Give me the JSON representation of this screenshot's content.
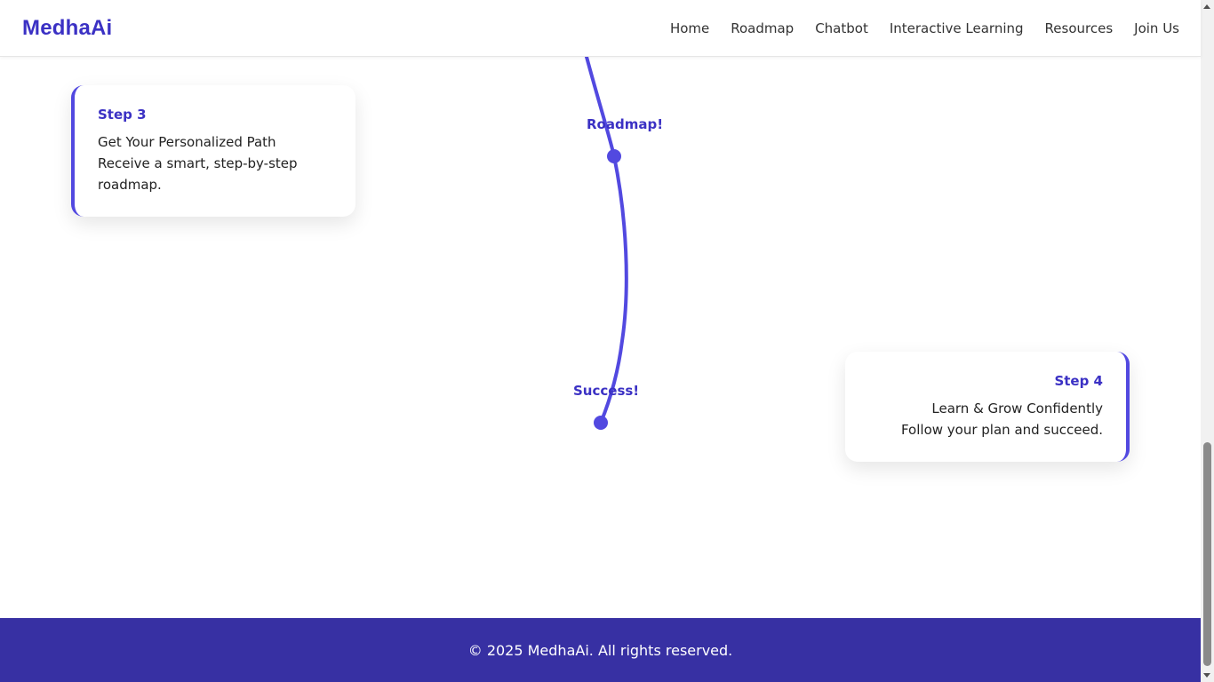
{
  "nav": {
    "logo": "MedhaAi",
    "links": [
      "Home",
      "Roadmap",
      "Chatbot",
      "Interactive Learning",
      "Resources",
      "Join Us"
    ]
  },
  "milestones": [
    {
      "label": "Roadmap!"
    },
    {
      "label": "Success!"
    }
  ],
  "cards": [
    {
      "step": "Step 3",
      "title": "Get Your Personalized Path",
      "desc": "Receive a smart, step-by-step roadmap."
    },
    {
      "step": "Step 4",
      "title": "Learn & Grow Confidently",
      "desc": "Follow your plan and succeed."
    }
  ],
  "footer": {
    "text": "© 2025 MedhaAi. All rights reserved."
  },
  "colors": {
    "accent": "#3b31c4",
    "path": "#5249e0",
    "footer_bg": "#3730a3"
  }
}
